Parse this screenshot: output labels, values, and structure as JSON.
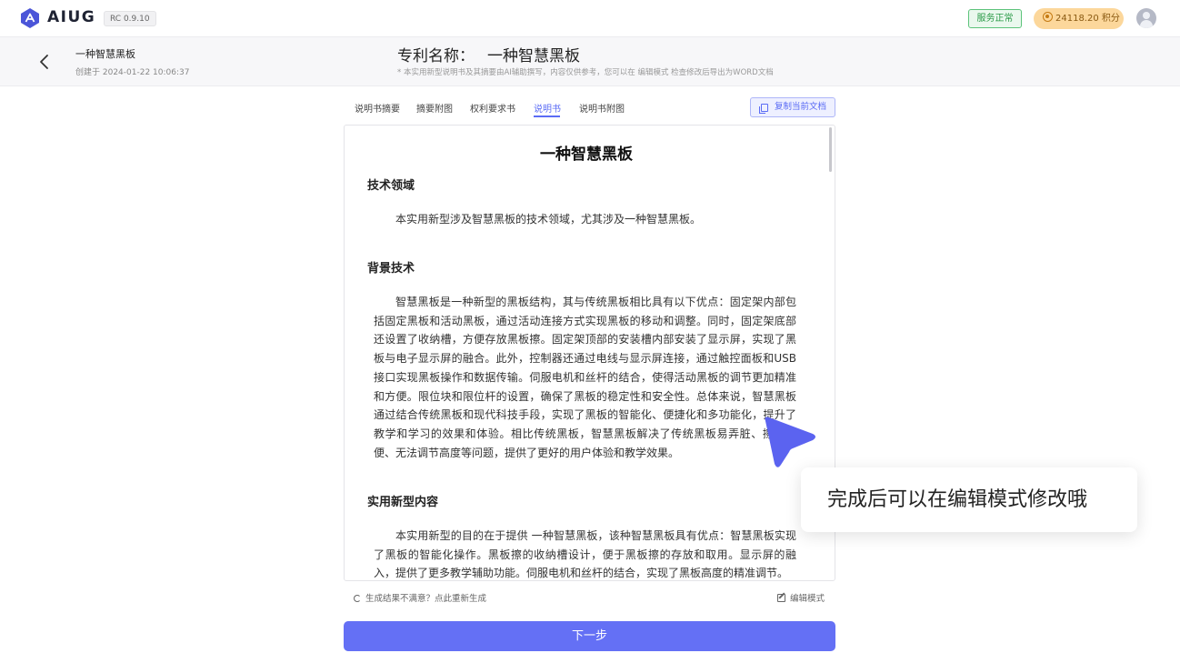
{
  "app": {
    "brand": "AIUG",
    "version": "RC 0.9.10",
    "status": "服务正常",
    "points": "24118.20 积分"
  },
  "header": {
    "doc_name": "一种智慧黑板",
    "created": "创建于 2024-01-22 10:06:37",
    "patent_label": "专利名称：",
    "patent_value": "一种智慧黑板",
    "note": "* 本实用新型说明书及其摘要由AI辅助撰写，内容仅供参考，您可以在 编辑模式 检查修改后导出为WORD文档"
  },
  "tabs": [
    {
      "label": "说明书摘要",
      "active": false
    },
    {
      "label": "摘要附图",
      "active": false
    },
    {
      "label": "权利要求书",
      "active": false
    },
    {
      "label": "说明书",
      "active": true
    },
    {
      "label": "说明书附图",
      "active": false
    }
  ],
  "copy_button": "复制当前文档",
  "document": {
    "title": "一种智慧黑板",
    "sections": [
      {
        "heading": "技术领域",
        "text": "本实用新型涉及智慧黑板的技术领域，尤其涉及一种智慧黑板。"
      },
      {
        "heading": "背景技术",
        "text": "智慧黑板是一种新型的黑板结构，其与传统黑板相比具有以下优点：固定架内部包括固定黑板和活动黑板，通过活动连接方式实现黑板的移动和调整。同时，固定架底部还设置了收纳槽，方便存放黑板擦。固定架顶部的安装槽内部安装了显示屏，实现了黑板与电子显示屏的融合。此外，控制器还通过电线与显示屏连接，通过触控面板和USB接口实现黑板操作和数据传输。伺服电机和丝杆的结合，使得活动黑板的调节更加精准和方便。限位块和限位杆的设置，确保了黑板的稳定性和安全性。总体来说，智慧黑板通过结合传统黑板和现代科技手段，实现了黑板的智能化、便捷化和多功能化，提升了教学和学习的效果和体验。相比传统黑板，智慧黑板解决了传统黑板易弄脏、擦拭不便、无法调节高度等问题，提供了更好的用户体验和教学效果。"
      },
      {
        "heading": "实用新型内容",
        "text": "本实用新型的目的在于提供 一种智慧黑板，该种智慧黑板具有优点：智慧黑板实现了黑板的智能化操作。黑板擦的收纳槽设计，便于黑板擦的存放和取用。显示屏的融入，提供了更多教学辅助功能。伺服电机和丝杆的结合，实现了黑板高度的精准调节。"
      }
    ]
  },
  "footer": {
    "regenerate": "生成结果不满意？点此重新生成",
    "edit_mode": "编辑模式",
    "next": "下一步"
  },
  "guide": {
    "tip": "完成后可以在编辑模式修改哦"
  },
  "colors": {
    "accent": "#6470f5",
    "status_green": "#2a9a47",
    "points_bg": "#fcd79b"
  }
}
